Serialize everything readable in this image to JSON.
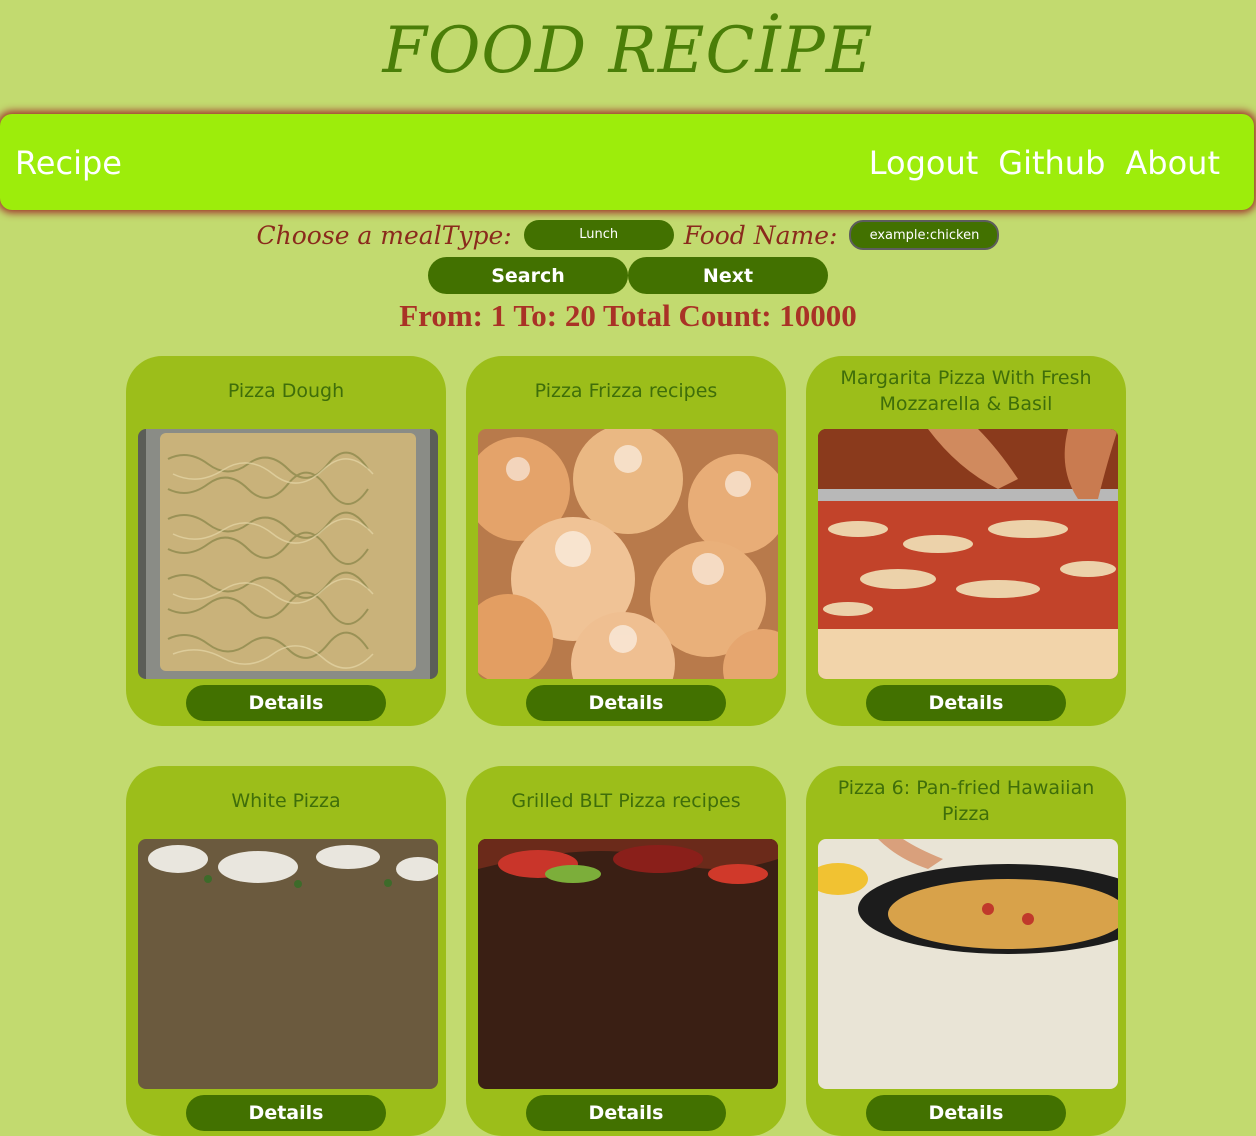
{
  "site": {
    "title": "FOOD RECİPE"
  },
  "nav": {
    "brand": "Recipe",
    "links": [
      "Logout",
      "Github",
      "About"
    ]
  },
  "search": {
    "meal_label": "Choose a mealType:",
    "meal_value": "Lunch",
    "food_label": "Food Name:",
    "food_placeholder": "example:chicken",
    "search_button": "Search",
    "next_button": "Next"
  },
  "results": {
    "summary": "From: 1 To: 20 Total Count: 10000"
  },
  "cards": [
    {
      "title": "Pizza Dough",
      "details": "Details"
    },
    {
      "title": "Pizza Frizza recipes",
      "details": "Details"
    },
    {
      "title": "Margarita Pizza With Fresh Mozzarella & Basil",
      "details": "Details"
    },
    {
      "title": "White Pizza",
      "details": "Details"
    },
    {
      "title": "Grilled BLT Pizza recipes",
      "details": "Details"
    },
    {
      "title": "Pizza 6: Pan-fried Hawaiian Pizza",
      "details": "Details"
    }
  ],
  "colors": {
    "background": "#c2da6f",
    "navbar": "#9ded0b",
    "card": "#9cbe1a",
    "button": "#427100",
    "accent_red": "#a93226",
    "title_green": "#4a7e08"
  }
}
